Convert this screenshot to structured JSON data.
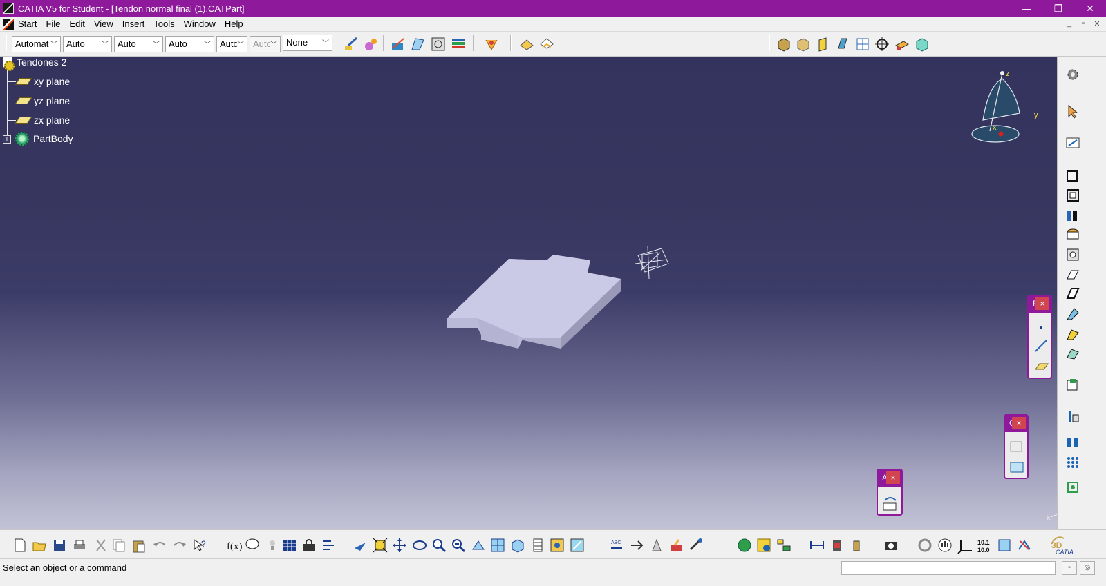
{
  "window": {
    "title": "CATIA V5 for Student - [Tendon normal final (1).CATPart]",
    "controls": {
      "minimize": "—",
      "restore": "❐",
      "close": "✕"
    }
  },
  "menubar": {
    "items": [
      {
        "label": "Start",
        "mnemonic": "S"
      },
      {
        "label": "File",
        "mnemonic": "F"
      },
      {
        "label": "Edit",
        "mnemonic": "E"
      },
      {
        "label": "View",
        "mnemonic": "V"
      },
      {
        "label": "Insert",
        "mnemonic": "I"
      },
      {
        "label": "Tools",
        "mnemonic": "T"
      },
      {
        "label": "Window",
        "mnemonic": "W"
      },
      {
        "label": "Help",
        "mnemonic": "H"
      }
    ],
    "doc_controls": {
      "minimize": "_",
      "restore": "▫",
      "close": "✕"
    }
  },
  "toolbar": {
    "combos": [
      {
        "value": "Automat",
        "disabled": false
      },
      {
        "value": "Auto",
        "disabled": false
      },
      {
        "value": "Auto",
        "disabled": false
      },
      {
        "value": "Auto",
        "disabled": false
      },
      {
        "value": "Autc",
        "disabled": false
      },
      {
        "value": "Autc",
        "disabled": true
      },
      {
        "value": "None",
        "disabled": false
      }
    ]
  },
  "tree": {
    "root": "Tendones 2",
    "children": [
      "xy plane",
      "yz plane",
      "zx plane"
    ],
    "body": "PartBody"
  },
  "compass": {
    "z": "z",
    "y": "y",
    "x": "x"
  },
  "axis_triad": {
    "z": "z",
    "y": "y",
    "x": "x"
  },
  "floating_toolbars": [
    {
      "title": "R",
      "close": "×"
    },
    {
      "title": "C",
      "close": "×"
    },
    {
      "title": "A",
      "close": "×"
    }
  ],
  "statusbar": {
    "message": "Select an object or a command"
  },
  "colors": {
    "titlebar": "#8e1a9b",
    "viewport_top": "#33335e",
    "viewport_bottom": "#c3c3d6",
    "part_face": "#c8c8e4"
  }
}
